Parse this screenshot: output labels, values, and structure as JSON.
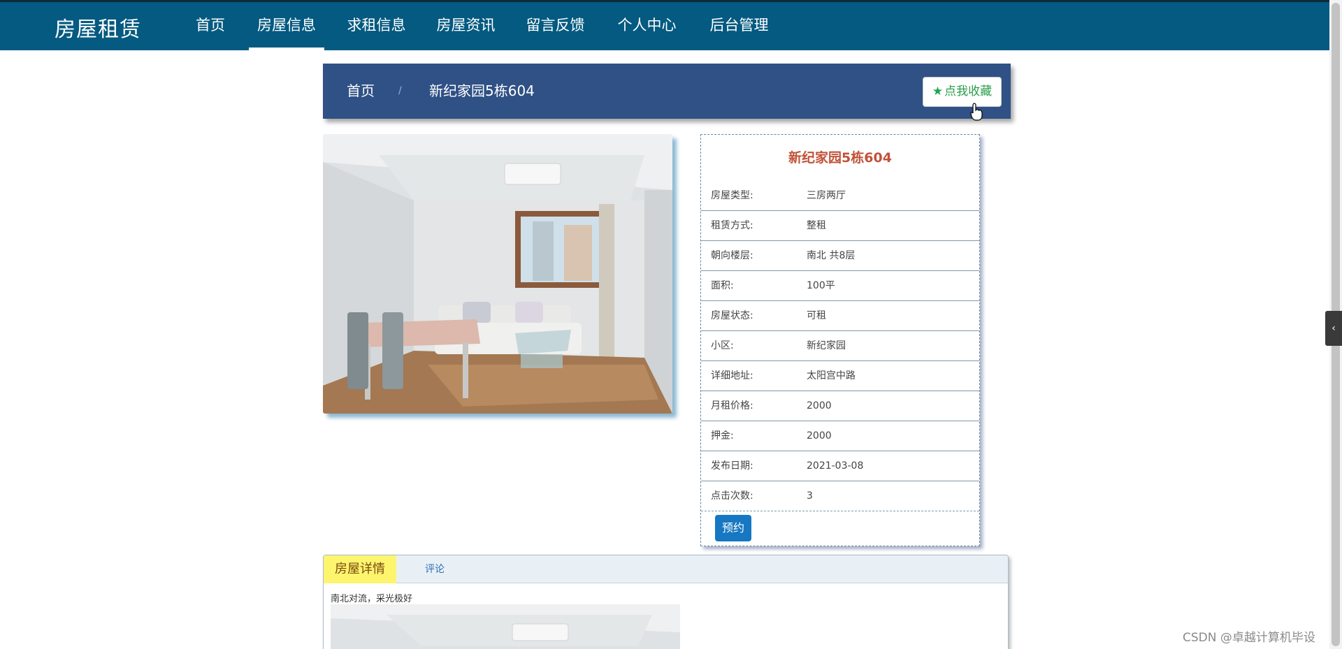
{
  "nav": {
    "brand": "房屋租赁",
    "items": [
      {
        "label": "首页",
        "active": false
      },
      {
        "label": "房屋信息",
        "active": true
      },
      {
        "label": "求租信息",
        "active": false
      },
      {
        "label": "房屋资讯",
        "active": false
      },
      {
        "label": "留言反馈",
        "active": false
      },
      {
        "label": "个人中心",
        "active": false
      },
      {
        "label": "后台管理",
        "active": false
      }
    ]
  },
  "breadcrumb": {
    "home": "首页",
    "separator": "/",
    "current": "新纪家园5栋604",
    "favorite_label": "点我收藏"
  },
  "house": {
    "title": "新纪家园5栋604",
    "fields": [
      {
        "key": "房屋类型:",
        "value": "三房两厅"
      },
      {
        "key": "租赁方式:",
        "value": "整租"
      },
      {
        "key": "朝向楼层:",
        "value": "南北 共8层"
      },
      {
        "key": "面积:",
        "value": "100平"
      },
      {
        "key": "房屋状态:",
        "value": "可租"
      },
      {
        "key": "小区:",
        "value": "新纪家园"
      },
      {
        "key": "详细地址:",
        "value": "太阳宫中路"
      },
      {
        "key": "月租价格:",
        "value": "2000"
      },
      {
        "key": "押金:",
        "value": "2000"
      },
      {
        "key": "发布日期:",
        "value": "2021-03-08"
      },
      {
        "key": "点击次数:",
        "value": "3"
      }
    ],
    "book_label": "预约"
  },
  "tabs": {
    "items": [
      {
        "label": "房屋详情",
        "active": true
      },
      {
        "label": "评论",
        "active": false
      }
    ],
    "detail_text": "南北对流，采光极好"
  },
  "watermark": "CSDN @卓越计算机毕设",
  "colors": {
    "nav_bg": "#045a80",
    "crumb_bg": "#2f5185",
    "title_red": "#c0533a",
    "book_blue": "#1677c2",
    "tab_active": "#fdf56d"
  }
}
